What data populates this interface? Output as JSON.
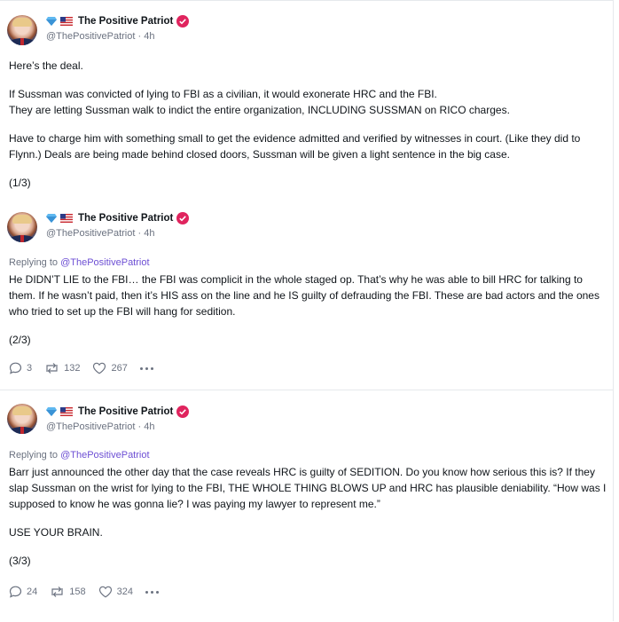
{
  "author": {
    "name": "The Positive Patriot",
    "handle_line": "@ThePositivePatriot · 4h"
  },
  "posts": [
    {
      "paragraphs": [
        "Here’s the deal.",
        "If Sussman was convicted of lying to FBI as a civilian, it would exonerate HRC and the FBI.",
        "They are letting Sussman walk to indict the entire organization, INCLUDING SUSSMAN on RICO charges.",
        "Have to charge him with something small to get the evidence admitted and verified by witnesses in court. (Like they did to Flynn.) Deals are being made behind closed doors, Sussman will be given a light sentence in the big case.",
        "(1/3)"
      ]
    },
    {
      "replying_prefix": "Replying to ",
      "replying_to": "@ThePositivePatriot",
      "paragraphs": [
        "He DIDN’T LIE to the FBI… the FBI was complicit in the whole staged op. That’s why he was able to bill HRC for talking to them. If he wasn’t paid, then it’s HIS ass on the line and he IS guilty of defrauding the FBI. These are bad actors and the ones who tried to set up the FBI will hang for sedition.",
        "(2/3)"
      ],
      "stats": {
        "replies": "3",
        "reposts": "132",
        "likes": "267"
      }
    },
    {
      "replying_prefix": "Replying to ",
      "replying_to": "@ThePositivePatriot",
      "paragraphs": [
        "Barr just announced the other day that the case reveals HRC is guilty of SEDITION. Do you know how serious this is? If they slap Sussman on the wrist for lying to the FBI, THE WHOLE THING BLOWS UP and HRC has plausible deniability. “How was I supposed to know he was gonna lie? I was paying my lawyer to represent me.”",
        "USE YOUR BRAIN.",
        "(3/3)"
      ],
      "stats": {
        "replies": "24",
        "reposts": "158",
        "likes": "324"
      }
    }
  ],
  "icons": [
    "gem-icon",
    "us-flag-icon",
    "verified-badge-icon",
    "reply-icon",
    "repost-icon",
    "like-icon",
    "more-icon"
  ],
  "colors": {
    "mention": "#6d4fd4",
    "verified": "#e0245e",
    "muted": "#6b7280"
  }
}
